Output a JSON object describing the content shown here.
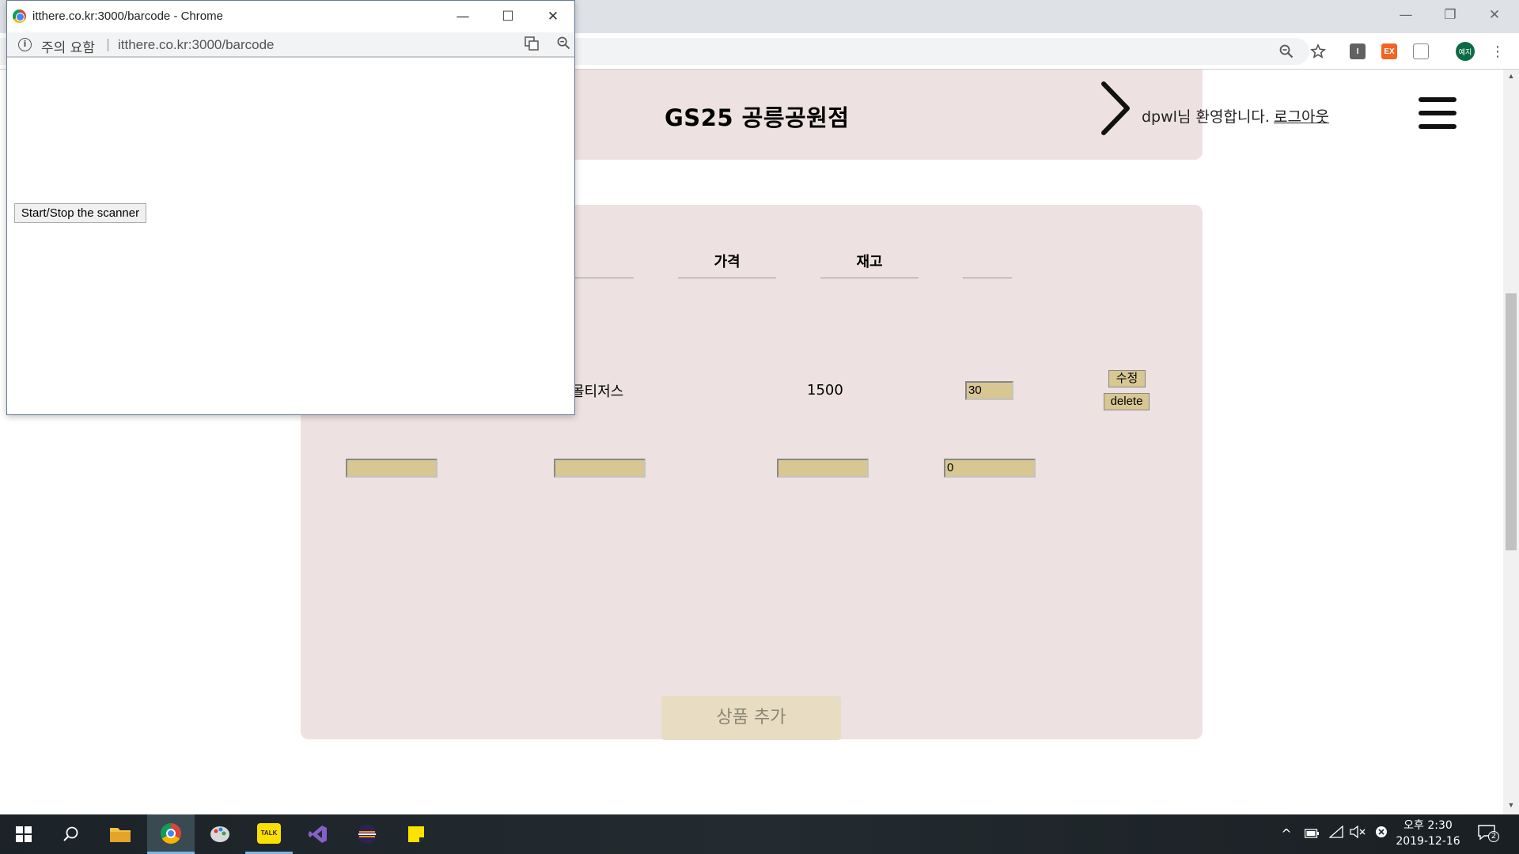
{
  "main_window": {
    "controls": {
      "minimize": "—",
      "restore": "❐",
      "close": "✕"
    },
    "toolbar_icons": [
      "zoom-icon",
      "star-icon",
      "extension-i-icon",
      "extension-ex-icon",
      "extension-cast-icon",
      "profile-avatar",
      "menu-dots-icon"
    ],
    "ext_i": "I",
    "ext_ex": "EX",
    "avatar": "예지"
  },
  "page": {
    "store_title": "GS25 공릉공원점",
    "welcome": "dpwl님 환영합니다.",
    "logout": "로그아웃",
    "table": {
      "headers": [
        "가격",
        "재고"
      ],
      "row": {
        "name_partial": "몰티저스",
        "price": "1500",
        "stock": "30",
        "edit_label": "수정",
        "delete_label": "delete"
      },
      "new_row": {
        "stock_default": "0"
      }
    },
    "add_product": "상품 추가"
  },
  "popup": {
    "title": "itthere.co.kr:3000/barcode - Chrome",
    "security_warning": "주의 요함",
    "url": "itthere.co.kr:3000/barcode",
    "scanner_button": "Start/Stop the scanner"
  },
  "taskbar": {
    "apps": [
      "start-icon",
      "search-icon",
      "file-explorer-icon",
      "chrome-icon",
      "paint-icon",
      "kakaotalk-icon",
      "visual-studio-icon",
      "eclipse-icon",
      "sticky-notes-icon"
    ],
    "kakao_label": "TALK",
    "time": "오후 2:30",
    "date": "2019-12-16",
    "notification_count": "2"
  },
  "colors": {
    "panel": "#ede2e1",
    "input": "#d8c693",
    "add_button": "#e8dcc2",
    "taskbar": "#1f2a2f"
  }
}
